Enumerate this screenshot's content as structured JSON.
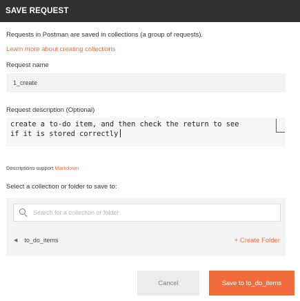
{
  "dialog": {
    "title": "SAVE REQUEST"
  },
  "intro": {
    "text": "Requests in Postman are saved in collections (a group of requests).",
    "link": "Learn more about creating collections"
  },
  "request_name": {
    "label": "Request name",
    "value": "1_create"
  },
  "request_description": {
    "label": "Request description (Optional)",
    "line1": "create a to-do item, and then check the return to see",
    "line2": "if it is stored correctly"
  },
  "markdown_note": {
    "prefix": "Descriptions support ",
    "link": "Markdown"
  },
  "collection": {
    "label": "Select a collection or folder to save to:",
    "search_placeholder": "Search for a collection or folder",
    "current_folder": "to_do_items",
    "create_folder": "+ Create Folder"
  },
  "buttons": {
    "cancel": "Cancel",
    "save": "Save to to_do_items"
  },
  "colors": {
    "accent": "#f26b3a",
    "header_bg": "#303030"
  },
  "icons": {
    "search": "search-icon",
    "back": "back-arrow-icon"
  }
}
